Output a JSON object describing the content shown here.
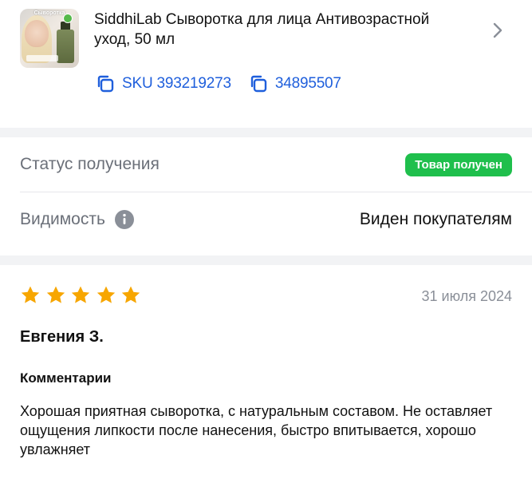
{
  "product": {
    "title": "SiddhiLab Сыворотка для лица Антивозрастной уход, 50 мл",
    "thumbnail_label": "Сыворотка",
    "sku_label": "SKU 393219273",
    "article_label": "34895507",
    "icons": {
      "copy": "copy-icon",
      "chevron": "chevron-right-icon"
    }
  },
  "status": {
    "receipt_label": "Статус получения",
    "receipt_badge": "Товар получен",
    "visibility_label": "Видимость",
    "visibility_value": "Виден покупателям",
    "badge_color": "#1fbf4c",
    "icons": {
      "info": "info-icon"
    }
  },
  "review": {
    "rating": 5,
    "date": "31 июля 2024",
    "author": "Евгения З.",
    "comments_title": "Комментарии",
    "comment": "Хорошая приятная сыворотка, с натуральным составом. Не оставляет ощущения липкости после нанесения, быстро впитывается, хорошо увлажняет",
    "star_color": "#f7a600"
  },
  "colors": {
    "accent": "#1f5fdc",
    "background_gap": "#f2f3f5"
  }
}
